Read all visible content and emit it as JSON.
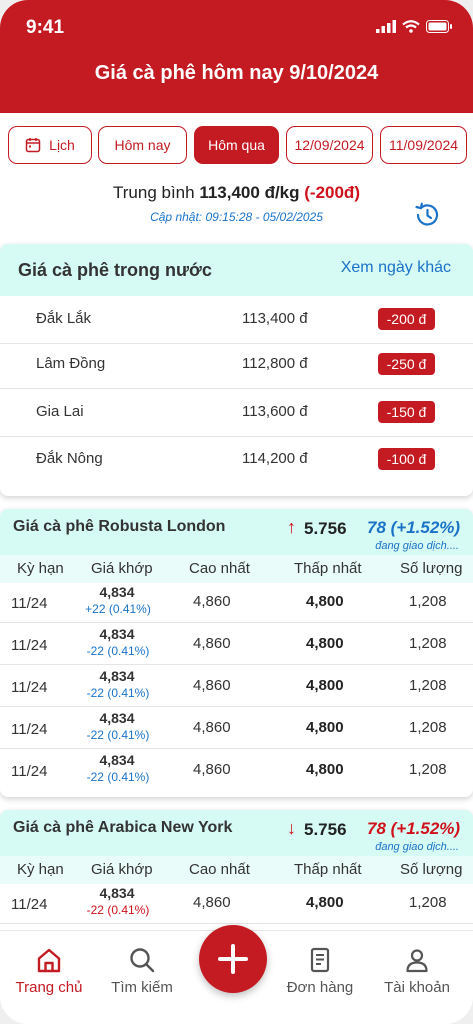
{
  "status": {
    "time": "9:41"
  },
  "header": {
    "title": "Giá cà phê hôm nay 9/10/2024"
  },
  "chips": [
    {
      "label": "Lịch",
      "icon": "calendar-icon"
    },
    {
      "label": "Hôm nay"
    },
    {
      "label": "Hôm qua",
      "active": true
    },
    {
      "label": "12/09/2024"
    },
    {
      "label": "11/09/2024"
    }
  ],
  "summary": {
    "prefix": "Trung bình",
    "value": "113,400 đ/kg",
    "change": "(-200đ)",
    "updated": "Cập nhật: 09:15:28 - 05/02/2025"
  },
  "domestic": {
    "title": "Giá cà phê trong nước",
    "link": "Xem ngày khác",
    "rows": [
      {
        "region": "Đắk Lắk",
        "price": "113,400 đ",
        "change": "-200 đ"
      },
      {
        "region": "Lâm Đồng",
        "price": "112,800 đ",
        "change": "-250 đ"
      },
      {
        "region": "Gia Lai",
        "price": "113,600 đ",
        "change": "-150 đ"
      },
      {
        "region": "Đắk Nông",
        "price": "114,200 đ",
        "change": "-100 đ"
      }
    ]
  },
  "columns": [
    "Kỳ hạn",
    "Giá khớp",
    "Cao nhất",
    "Thấp nhất",
    "Số lượng"
  ],
  "robusta": {
    "title": "Giá cà phê Robusta London",
    "arrow": "↑",
    "price": "5.756",
    "change": "78 (+1.52%)",
    "trading": "đang giao dịch....",
    "rows": [
      {
        "term": "11/24",
        "match": "4,834",
        "diff": "+22 (0.41%)",
        "high": "4,860",
        "low": "4,800",
        "volume": "1,208"
      },
      {
        "term": "11/24",
        "match": "4,834",
        "diff": "-22 (0.41%)",
        "high": "4,860",
        "low": "4,800",
        "volume": "1,208"
      },
      {
        "term": "11/24",
        "match": "4,834",
        "diff": "-22 (0.41%)",
        "high": "4,860",
        "low": "4,800",
        "volume": "1,208"
      },
      {
        "term": "11/24",
        "match": "4,834",
        "diff": "-22 (0.41%)",
        "high": "4,860",
        "low": "4,800",
        "volume": "1,208"
      },
      {
        "term": "11/24",
        "match": "4,834",
        "diff": "-22 (0.41%)",
        "high": "4,860",
        "low": "4,800",
        "volume": "1,208"
      }
    ]
  },
  "arabica": {
    "title": "Giá cà phê Arabica New York",
    "arrow": "↓",
    "price": "5.756",
    "change": "78 (+1.52%)",
    "trading": "đang giao dịch....",
    "rows": [
      {
        "term": "11/24",
        "match": "4,834",
        "diff": "-22 (0.41%)",
        "high": "4,860",
        "low": "4,800",
        "volume": "1,208"
      }
    ]
  },
  "tabbar": {
    "items": [
      {
        "label": "Trang chủ",
        "icon": "home-icon",
        "active": true
      },
      {
        "label": "Tìm kiếm",
        "icon": "search-icon"
      },
      {
        "label": "Đơn hàng",
        "icon": "document-icon"
      },
      {
        "label": "Tài khoản",
        "icon": "user-icon"
      }
    ],
    "fab_icon": "plus-icon"
  },
  "colors": {
    "brand_red": "#c41a22",
    "mint": "#d6faf4",
    "link_blue": "#1a73c8",
    "up_blue": "#1a73c8",
    "down_red": "#d0101a"
  }
}
